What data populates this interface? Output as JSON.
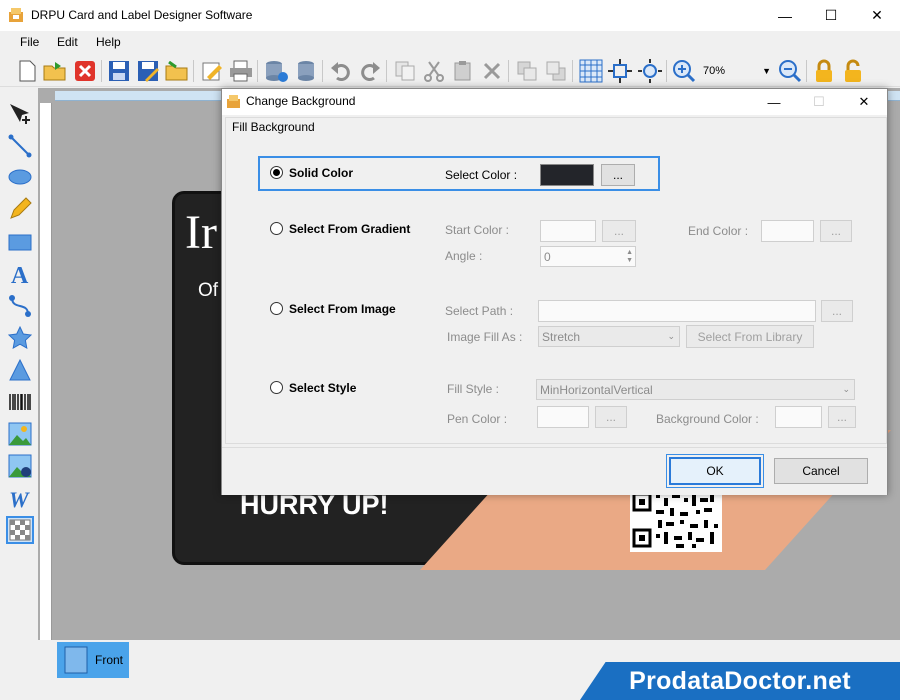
{
  "window": {
    "title": "DRPU Card and Label Designer Software"
  },
  "menu": {
    "file": "File",
    "edit": "Edit",
    "help": "Help"
  },
  "toolbar": {
    "zoom_value": "70%"
  },
  "card": {
    "headline": "HURRY UP!",
    "logo_letter": "Ir",
    "of_text": "Of"
  },
  "tabs": {
    "front": "Front"
  },
  "brand": {
    "text": "ProdataDoctor.net"
  },
  "dialog": {
    "title": "Change Background",
    "group_label": "Fill Background",
    "solid": {
      "label": "Solid Color",
      "select_color_label": "Select Color :",
      "color": "#23252a",
      "browse": "..."
    },
    "gradient": {
      "label": "Select From Gradient",
      "start_label": "Start Color :",
      "end_label": "End Color :",
      "angle_label": "Angle :",
      "angle_value": "0",
      "browse": "..."
    },
    "image": {
      "label": "Select From Image",
      "path_label": "Select Path :",
      "fill_as_label": "Image Fill As :",
      "fill_as_value": "Stretch",
      "library_button": "Select From Library",
      "browse": "..."
    },
    "style": {
      "label": "Select Style",
      "fill_style_label": "Fill Style :",
      "fill_style_value": "MinHorizontalVertical",
      "pen_label": "Pen Color :",
      "bg_label": "Background Color :",
      "browse": "..."
    },
    "ok": "OK",
    "cancel": "Cancel"
  }
}
